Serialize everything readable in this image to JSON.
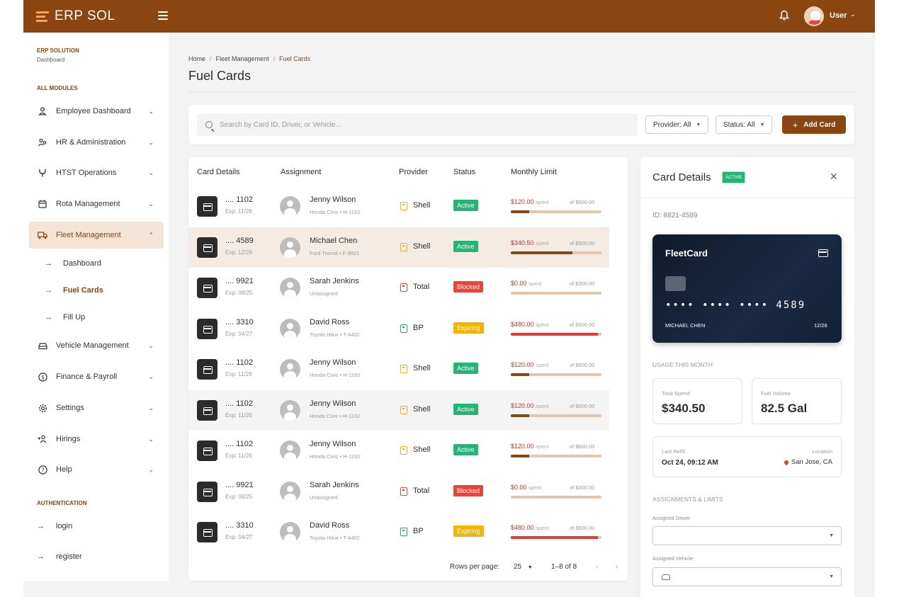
{
  "app": {
    "brand": "ERP SOL",
    "user_label": "User"
  },
  "colors": {
    "primary": "#8a4510",
    "active": "#22b573",
    "blocked": "#e5463b",
    "expiring": "#f4b400"
  },
  "sidebar": {
    "brand": "ERP SOLUTION",
    "subtitle": "Dashboard",
    "section_modules": "ALL MODULES",
    "items": [
      {
        "label": "Employee Dashboard",
        "icon": "user-icon"
      },
      {
        "label": "HR & Administration",
        "icon": "users-icon"
      },
      {
        "label": "HTST Operations",
        "icon": "fork-icon"
      },
      {
        "label": "Rota Management",
        "icon": "calendar-icon"
      },
      {
        "label": "Fleet Management",
        "icon": "truck-icon"
      },
      {
        "label": "Vehicle Management",
        "icon": "car-icon"
      },
      {
        "label": "Finance & Payroll",
        "icon": "dollar-icon"
      },
      {
        "label": "Settings",
        "icon": "gear-icon"
      },
      {
        "label": "Hirings",
        "icon": "add-user-icon"
      },
      {
        "label": "Help",
        "icon": "help-icon"
      }
    ],
    "fleet_sub": [
      {
        "label": "Dashboard"
      },
      {
        "label": "Fuel Cards"
      },
      {
        "label": "Fill Up"
      }
    ],
    "section_auth": "AUTHENTICATION",
    "auth": [
      {
        "label": "login"
      },
      {
        "label": "register"
      }
    ]
  },
  "breadcrumb": {
    "home": "Home",
    "parent": "Fleet Management",
    "current": "Fuel Cards"
  },
  "page_title": "Fuel Cards",
  "toolbar": {
    "search_placeholder": "Search by Card ID, Driver, or Vehicle...",
    "provider_filter": "Provider: All",
    "status_filter": "Status: All",
    "add_label": "Add Card"
  },
  "table": {
    "headers": [
      "Card Details",
      "Assignment",
      "Provider",
      "Status",
      "Monthly Limit"
    ],
    "spent_suffix": "spent",
    "rows": [
      {
        "card": ".... 1102",
        "exp": "Exp: 11/26",
        "driver": "Jenny Wilson",
        "vehicle": "Honda Civic • H-1192",
        "provider": "Shell",
        "status": "Active",
        "spent": "$120.00",
        "limit": "of $600.00",
        "usage": 0.2
      },
      {
        "card": ".... 4589",
        "exp": "Exp: 12/26",
        "driver": "Michael Chen",
        "vehicle": "Ford Transit • F-8921",
        "provider": "Shell",
        "status": "Active",
        "spent": "$340.50",
        "limit": "of $500.00",
        "usage": 0.68
      },
      {
        "card": ".... 9921",
        "exp": "Exp: 08/25",
        "driver": "Sarah Jenkins",
        "vehicle": "Unassigned",
        "provider": "Total",
        "status": "Blocked",
        "spent": "$0.00",
        "limit": "of $300.00",
        "usage": 0
      },
      {
        "card": ".... 3310",
        "exp": "Exp: 04/27",
        "driver": "David Ross",
        "vehicle": "Toyota Hilux • T-4402",
        "provider": "BP",
        "status": "Expiring",
        "spent": "$480.00",
        "limit": "of $500.00",
        "usage": 0.96
      },
      {
        "card": ".... 1102",
        "exp": "Exp: 11/26",
        "driver": "Jenny Wilson",
        "vehicle": "Honda Civic • H-1192",
        "provider": "Shell",
        "status": "Active",
        "spent": "$120.00",
        "limit": "of $600.00",
        "usage": 0.2
      },
      {
        "card": ".... 1102",
        "exp": "Exp: 11/26",
        "driver": "Jenny Wilson",
        "vehicle": "Honda Civic • H-1192",
        "provider": "Shell",
        "status": "Active",
        "spent": "$120.00",
        "limit": "of $600.00",
        "usage": 0.2
      },
      {
        "card": ".... 1102",
        "exp": "Exp: 11/26",
        "driver": "Jenny Wilson",
        "vehicle": "Honda Civic • H-1192",
        "provider": "Shell",
        "status": "Active",
        "spent": "$120.00",
        "limit": "of $600.00",
        "usage": 0.2
      },
      {
        "card": ".... 9921",
        "exp": "Exp: 08/25",
        "driver": "Sarah Jenkins",
        "vehicle": "Unassigned",
        "provider": "Total",
        "status": "Blocked",
        "spent": "$0.00",
        "limit": "of $300.00",
        "usage": 0
      },
      {
        "card": ".... 3310",
        "exp": "Exp: 04/27",
        "driver": "David Ross",
        "vehicle": "Toyota Hilux • T-4402",
        "provider": "BP",
        "status": "Expiring",
        "spent": "$480.00",
        "limit": "of $500.00",
        "usage": 0.96
      }
    ],
    "pager": {
      "rows_label": "Rows per page:",
      "rows_value": "25",
      "range": "1–8 of 8"
    }
  },
  "detail": {
    "title": "Card Details",
    "badge": "ACTIVE",
    "id": "ID: 8821-4589",
    "card": {
      "brand": "FleetCard",
      "number": "•••• •••• •••• 4589",
      "holder": "MICHAEL CHEN",
      "exp": "12/26"
    },
    "usage_label": "USAGE THIS MONTH",
    "total_spend_label": "Total Spend",
    "total_spend": "$340.50",
    "fuel_volume_label": "Fuel Volume",
    "fuel_volume": "82.5 Gal",
    "last_refill_label": "Last Refill",
    "last_refill": "Oct 24, 09:12 AM",
    "location_label": "Location",
    "location": "San Jose, CA",
    "assignments_label": "ASSIGNMENTS & LIMITS",
    "driver_label": "Assigned Driver",
    "vehicle_label": "Assigned Vehicle"
  }
}
